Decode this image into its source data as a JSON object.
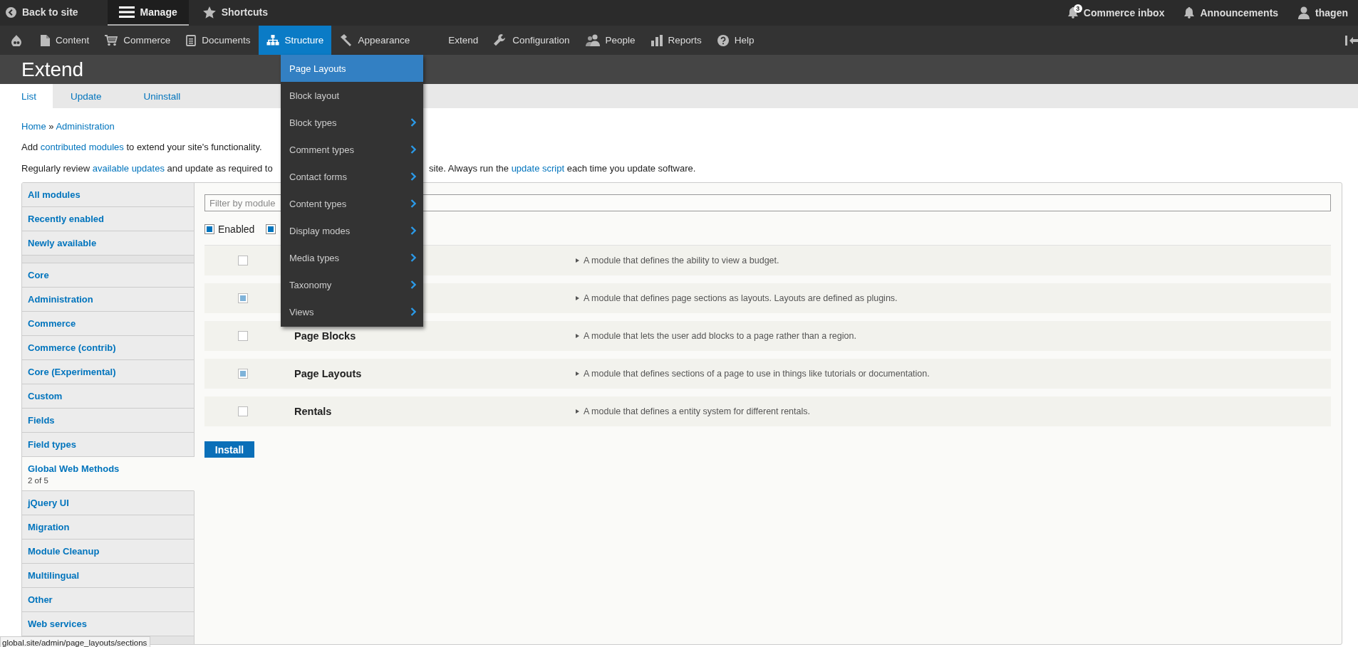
{
  "toolbar": {
    "items": [
      {
        "label": "Back to site",
        "selected": false
      },
      {
        "label": "Manage",
        "selected": true
      },
      {
        "label": "Shortcuts",
        "selected": false
      }
    ],
    "user_items": [
      {
        "label": "Commerce inbox",
        "badge": "3"
      },
      {
        "label": "Announcements"
      },
      {
        "label": "thagen"
      }
    ]
  },
  "tray": {
    "items": [
      {
        "label": "Content",
        "selected": false
      },
      {
        "label": "Commerce",
        "selected": false
      },
      {
        "label": "Documents",
        "selected": false
      },
      {
        "label": "Structure",
        "selected": true
      },
      {
        "label": "Appearance",
        "selected": false
      },
      {
        "label": "Extend",
        "selected": false
      },
      {
        "label": "Configuration",
        "selected": false
      },
      {
        "label": "People",
        "selected": false
      },
      {
        "label": "Reports",
        "selected": false
      },
      {
        "label": "Help",
        "selected": false
      }
    ]
  },
  "structure_menu": {
    "items": [
      {
        "label": "Page Layouts",
        "selected": true,
        "has_submenu": false
      },
      {
        "label": "Block layout",
        "selected": false,
        "has_submenu": false
      },
      {
        "label": "Block types",
        "selected": false,
        "has_submenu": true
      },
      {
        "label": "Comment types",
        "selected": false,
        "has_submenu": true
      },
      {
        "label": "Contact forms",
        "selected": false,
        "has_submenu": true
      },
      {
        "label": "Content types",
        "selected": false,
        "has_submenu": true
      },
      {
        "label": "Display modes",
        "selected": false,
        "has_submenu": true
      },
      {
        "label": "Media types",
        "selected": false,
        "has_submenu": true
      },
      {
        "label": "Taxonomy",
        "selected": false,
        "has_submenu": true
      },
      {
        "label": "Views",
        "selected": false,
        "has_submenu": true
      }
    ]
  },
  "page": {
    "title": "Extend",
    "tabs": [
      {
        "label": "List",
        "selected": true
      },
      {
        "label": "Update",
        "selected": false
      },
      {
        "label": "Uninstall",
        "selected": false
      }
    ],
    "breadcrumb": [
      {
        "kind": "link",
        "text": "Home"
      },
      {
        "kind": "text",
        "text": " » "
      },
      {
        "kind": "link",
        "text": "Administration"
      }
    ],
    "intro": [
      {
        "kind": "text",
        "text": "Add "
      },
      {
        "kind": "link",
        "text": "contributed modules"
      },
      {
        "kind": "text",
        "text": " to extend your site's functionality."
      }
    ],
    "notice_left": [
      {
        "kind": "text",
        "text": "Regularly review "
      },
      {
        "kind": "link",
        "text": "available updates"
      },
      {
        "kind": "text",
        "text": " and update as required to"
      }
    ],
    "notice_right": [
      {
        "kind": "text",
        "text": "site. Always run the "
      },
      {
        "kind": "link",
        "text": "update script"
      },
      {
        "kind": "text",
        "text": " each time you update software."
      }
    ]
  },
  "modules": {
    "categories": [
      {
        "kind": "category",
        "label": "All modules",
        "selected": false
      },
      {
        "kind": "category",
        "label": "Recently enabled",
        "selected": false
      },
      {
        "kind": "category",
        "label": "Newly available",
        "selected": false
      },
      {
        "kind": "spacer"
      },
      {
        "kind": "category",
        "label": "Core",
        "selected": false
      },
      {
        "kind": "category",
        "label": "Administration",
        "selected": false
      },
      {
        "kind": "category",
        "label": "Commerce",
        "selected": false
      },
      {
        "kind": "category",
        "label": "Commerce (contrib)",
        "selected": false
      },
      {
        "kind": "category",
        "label": "Core (Experimental)",
        "selected": false
      },
      {
        "kind": "category",
        "label": "Custom",
        "selected": false
      },
      {
        "kind": "category",
        "label": "Fields",
        "selected": false
      },
      {
        "kind": "category",
        "label": "Field types",
        "selected": false
      },
      {
        "kind": "category",
        "label": "Global Web Methods",
        "selected": true,
        "count": "2 of 5"
      },
      {
        "kind": "category",
        "label": "jQuery UI",
        "selected": false
      },
      {
        "kind": "category",
        "label": "Migration",
        "selected": false
      },
      {
        "kind": "category",
        "label": "Module Cleanup",
        "selected": false
      },
      {
        "kind": "category",
        "label": "Multilingual",
        "selected": false
      },
      {
        "kind": "category",
        "label": "Other",
        "selected": false
      },
      {
        "kind": "category",
        "label": "Web services",
        "selected": false
      },
      {
        "kind": "spacer"
      }
    ],
    "filter": {
      "placeholder": "Filter by module"
    },
    "status_filters": [
      {
        "label": "Enabled",
        "checked": true
      },
      {
        "checked": true
      }
    ],
    "rows": [
      {
        "checked": false,
        "description": "A module that defines the ability to view a budget."
      },
      {
        "checked": true,
        "description": "A module that defines page sections as layouts. Layouts are defined as plugins."
      },
      {
        "name": "Page Blocks",
        "checked": false,
        "description": "A module that lets the user add blocks to a page rather than a region."
      },
      {
        "name": "Page Layouts",
        "checked": true,
        "description": "A module that defines sections of a page to use in things like tutorials or documentation."
      },
      {
        "name": "Rentals",
        "checked": false,
        "description": "A module that defines a entity system for different rentals."
      }
    ],
    "install_button": "Install"
  },
  "status_bar": "global.site/admin/page_layouts/sections"
}
